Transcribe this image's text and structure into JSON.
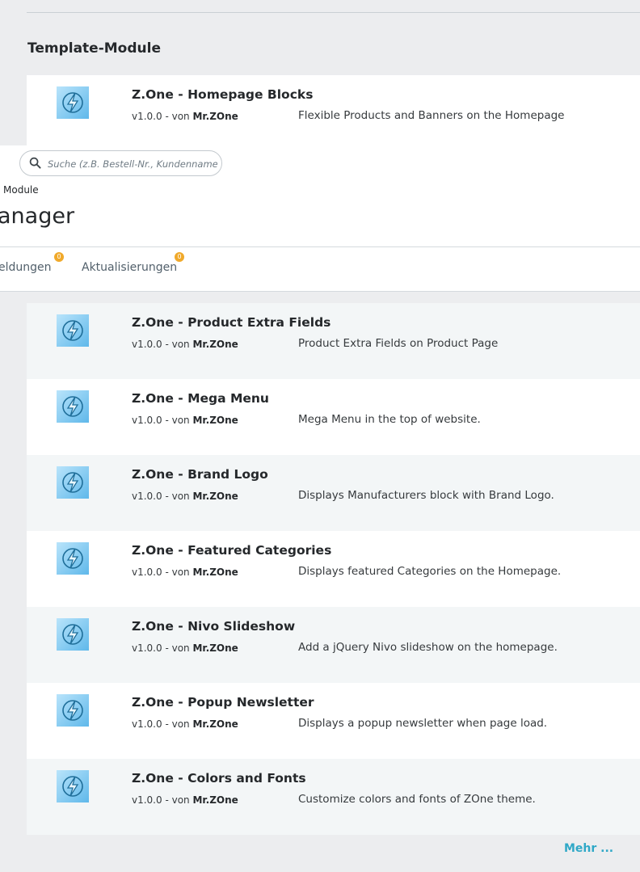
{
  "section": {
    "title": "Template-Module"
  },
  "header": {
    "search_placeholder": "Suche (z.B. Bestell-Nr., Kundenname ...)",
    "breadcrumb": "Module",
    "title": "anager",
    "tabs": [
      {
        "label": "eldungen",
        "badge": "0"
      },
      {
        "label": "Aktualisierungen",
        "badge": "0"
      }
    ]
  },
  "modules": [
    {
      "name": "Z.One - Homepage Blocks",
      "version": "v1.0.0 - von",
      "author": "Mr.ZOne",
      "description": "Flexible Products and Banners on the Homepage"
    },
    {
      "name": "Z.One - Product Extra Fields",
      "version": "v1.0.0 - von",
      "author": "Mr.ZOne",
      "description": "Product Extra Fields on Product Page"
    },
    {
      "name": "Z.One - Mega Menu",
      "version": "v1.0.0 - von",
      "author": "Mr.ZOne",
      "description": "Mega Menu in the top of website."
    },
    {
      "name": "Z.One - Brand Logo",
      "version": "v1.0.0 - von",
      "author": "Mr.ZOne",
      "description": "Displays Manufacturers block with Brand Logo."
    },
    {
      "name": "Z.One - Featured Categories",
      "version": "v1.0.0 - von",
      "author": "Mr.ZOne",
      "description": "Displays featured Categories on the Homepage."
    },
    {
      "name": "Z.One - Nivo Slideshow",
      "version": "v1.0.0 - von",
      "author": "Mr.ZOne",
      "description": "Add a jQuery Nivo slideshow on the homepage."
    },
    {
      "name": "Z.One - Popup Newsletter",
      "version": "v1.0.0 - von",
      "author": "Mr.ZOne",
      "description": "Displays a popup newsletter when page load."
    },
    {
      "name": "Z.One - Colors and Fonts",
      "version": "v1.0.0 - von",
      "author": "Mr.ZOne",
      "description": "Customize colors and fonts of ZOne theme."
    }
  ],
  "more_link": "Mehr ...",
  "colors": {
    "accent": "#2fa8c7",
    "badge": "#f0a92a",
    "row_alt": "#f3f6f7"
  }
}
